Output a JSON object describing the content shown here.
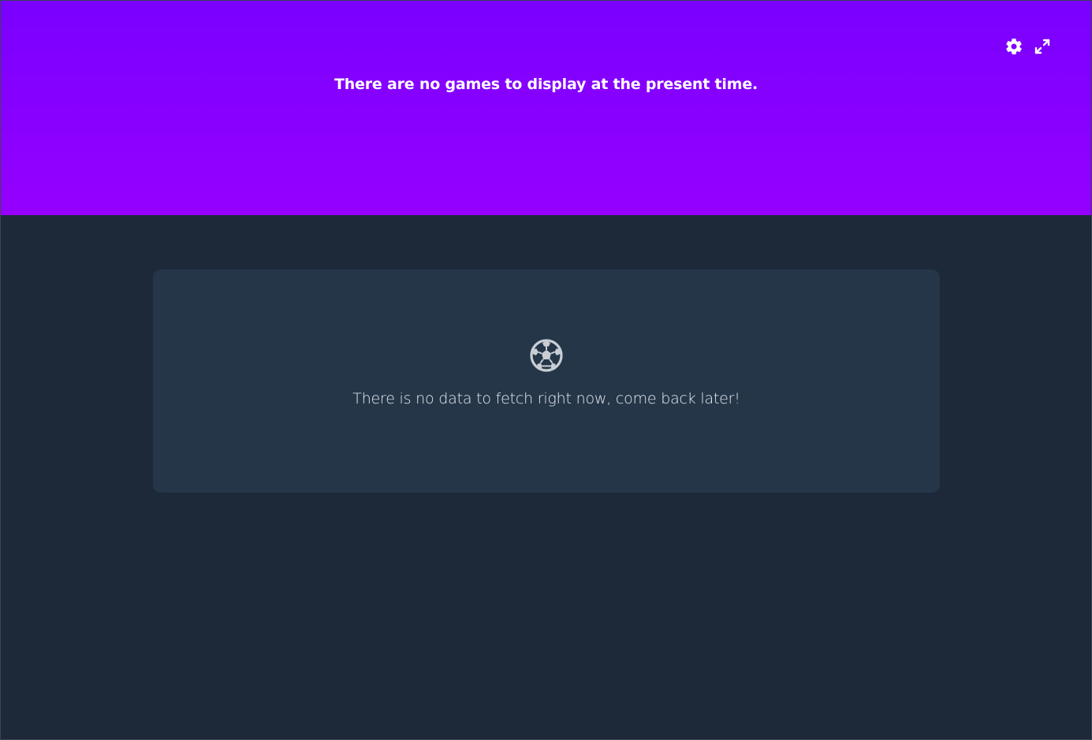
{
  "header": {
    "message": "There are no games to display at the present time.",
    "actions": [
      {
        "icon": "gear-icon"
      },
      {
        "icon": "expand-icon"
      }
    ],
    "gradient_top": "#7a00ff",
    "gradient_bottom": "#9500ff"
  },
  "empty_state": {
    "icon": "soccer-ball-icon",
    "message": "There is no data to fetch right now, come back later!"
  },
  "colors": {
    "page_background": "#1d2939",
    "card_background": "#253649",
    "text_primary": "#ffffff",
    "icon_muted": "#c9ced5"
  }
}
